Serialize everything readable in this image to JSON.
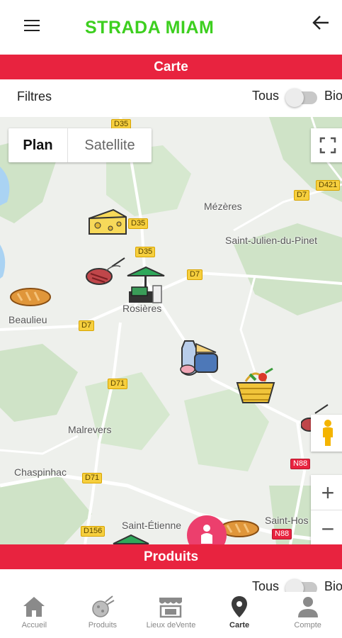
{
  "header": {
    "title": "STRADA MIAM",
    "title_color": "#3dcf1f",
    "menu_icon": "hamburger-menu-icon",
    "back_icon": "arrow-left-icon"
  },
  "carte_section": {
    "title": "Carte"
  },
  "filters": {
    "label": "Filtres",
    "all_label": "Tous",
    "bio_label": "Bio",
    "bio_toggle_on": false
  },
  "map": {
    "type_options": [
      "Plan",
      "Satellite"
    ],
    "selected_type": "Plan",
    "places": {
      "mezeres": "Mézères",
      "saint_julien": "Saint-Julien-du-Pinet",
      "rosieres": "Rosières",
      "beaulieu": "Beaulieu",
      "malrevers": "Malrevers",
      "chaspinhac": "Chaspinhac",
      "saint_etienne": "Saint-Étienne",
      "saint_hos": "Saint-Hos"
    },
    "roads": {
      "d35_top": "D35",
      "d35_a": "D35",
      "d35_b": "D35",
      "d7_a": "D7",
      "d7_b": "D7",
      "d7_c": "D7",
      "d421": "D421",
      "d71_a": "D71",
      "d71_b": "D71",
      "n88_a": "N88",
      "n88_b": "N88",
      "d156": "D156"
    },
    "zoom_in": "+",
    "zoom_out": "−",
    "markers": [
      "cheese-marker-icon",
      "grill-marker-icon",
      "market-stall-marker-icon",
      "bread-marker-icon",
      "dairy-marker-icon",
      "vegetable-basket-marker-icon",
      "bread-marker-icon-2",
      "grill-marker-icon-2"
    ]
  },
  "products_section": {
    "title": "Produits"
  },
  "products_filters": {
    "all_label": "Tous",
    "bio_label": "Bio"
  },
  "bottom_nav": {
    "items": [
      {
        "label": "Accueil",
        "icon": "home-icon",
        "active": false
      },
      {
        "label": "Produits",
        "icon": "produce-icon",
        "active": false
      },
      {
        "label": "Lieux deVente",
        "icon": "store-icon",
        "active": false
      },
      {
        "label": "Carte",
        "icon": "map-pin-icon",
        "active": true
      },
      {
        "label": "Compte",
        "icon": "account-icon",
        "active": false
      }
    ]
  },
  "colors": {
    "accent_red": "#e8233f",
    "brand_green": "#3dcf1f",
    "fab_pink": "#ec3f6d"
  }
}
